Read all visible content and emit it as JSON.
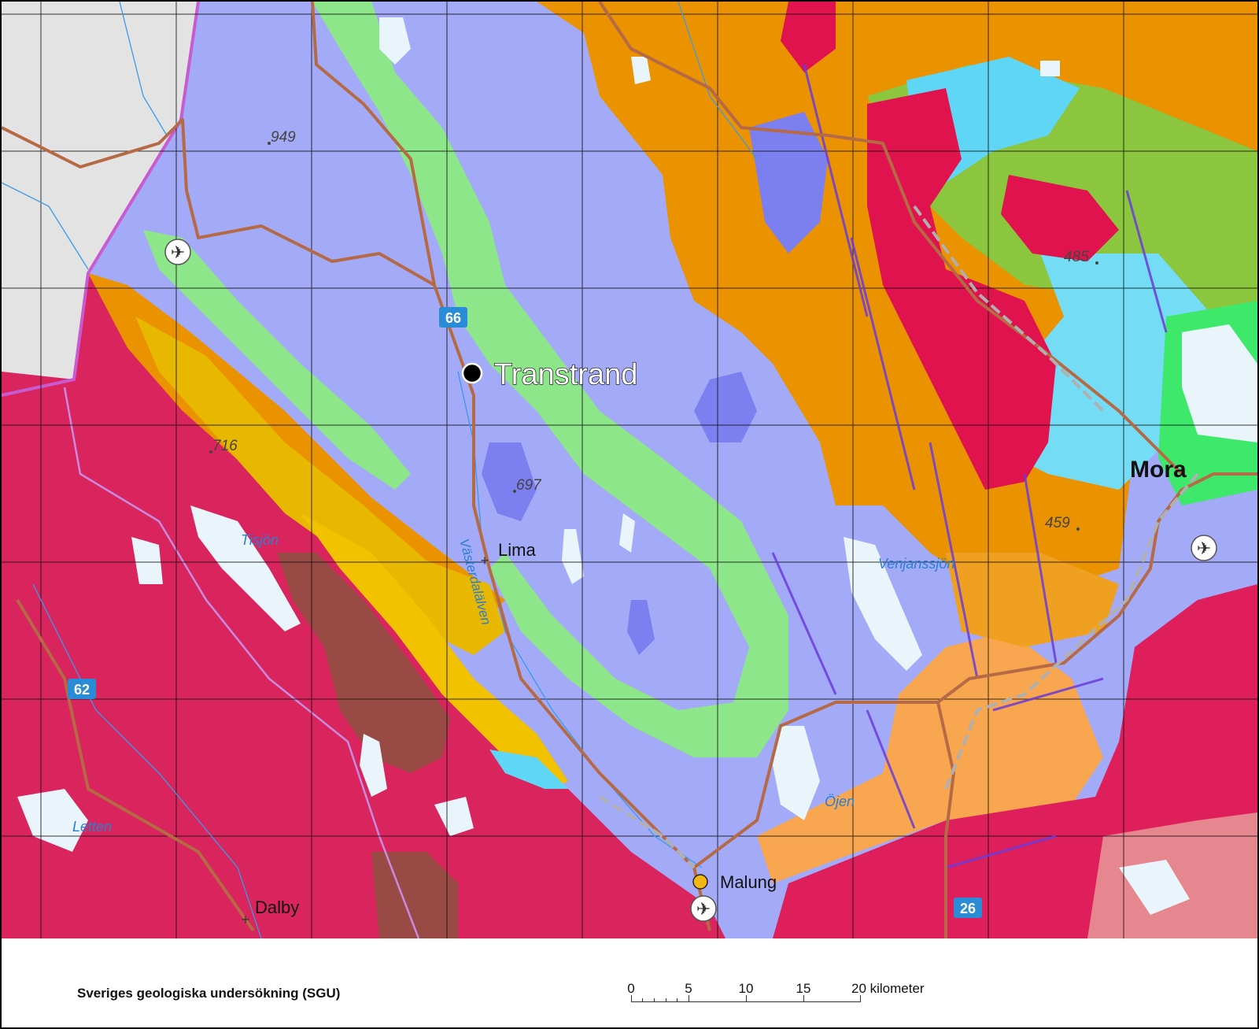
{
  "map": {
    "places": {
      "transtrand": "Transtrand",
      "mora": "Mora",
      "lima": "Lima",
      "malung": "Malung",
      "dalby": "Dalby"
    },
    "water": {
      "vasterdalalven": "Västerdalälven",
      "venjanssjon": "Venjanssjön",
      "ojen": "Öjen",
      "tisjon": "Tisjön",
      "letten": "Letten"
    },
    "roads": {
      "r66": "66",
      "r62": "62",
      "r26": "26"
    },
    "elevations": {
      "e949": "949",
      "e716": "716",
      "e697": "697",
      "e485": "485",
      "e459": "459"
    },
    "colors": {
      "purple_bedrock": "#a3aaf7",
      "deep_blue": "#7b7ff0",
      "green_band": "#8ee68a",
      "orange": "#eb9200",
      "yellow": "#e8b800",
      "magenta": "#d9245e",
      "crimson": "#e0134f",
      "brown": "#9a4a45",
      "lightblue": "#5fd6f5",
      "lime": "#8cc53e",
      "lake": "#e8f3fb",
      "grey_outside": "#e3e3e3",
      "road": "#b56a45"
    }
  },
  "footer": {
    "credit": "Sveriges geologiska undersökning (SGU)",
    "scale": {
      "labels": [
        "0",
        "5",
        "10",
        "15"
      ],
      "last_label": "20 kilometer"
    }
  }
}
